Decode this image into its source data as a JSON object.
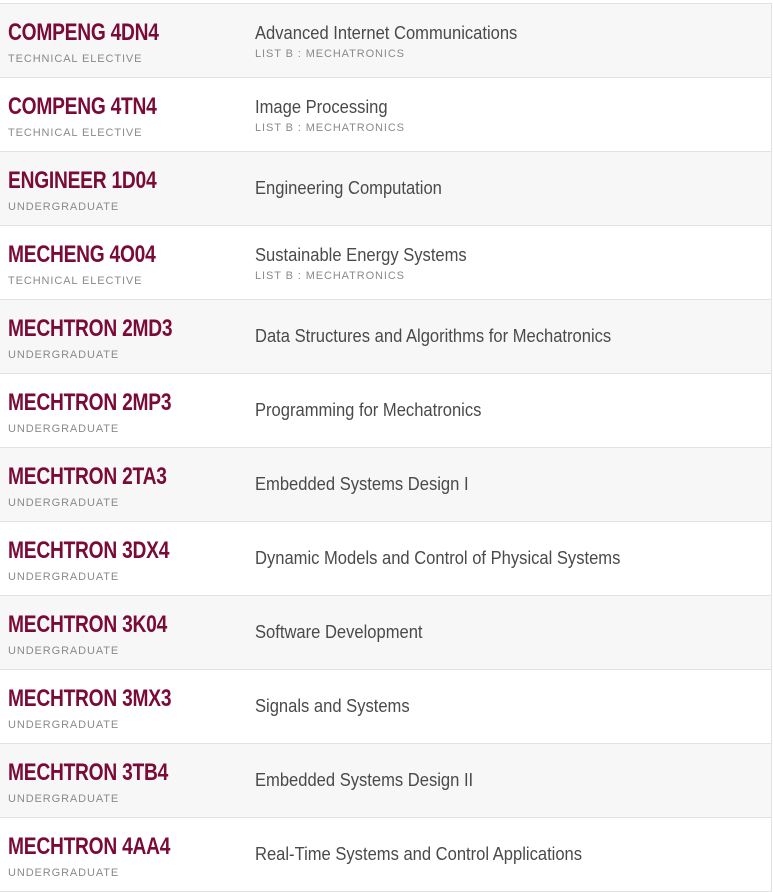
{
  "courses": [
    {
      "code": "COMPENG 4DN4",
      "level": "TECHNICAL ELECTIVE",
      "title": "Advanced Internet Communications",
      "list": "LIST B : MECHATRONICS"
    },
    {
      "code": "COMPENG 4TN4",
      "level": "TECHNICAL ELECTIVE",
      "title": "Image Processing",
      "list": "LIST B : MECHATRONICS"
    },
    {
      "code": "ENGINEER 1D04",
      "level": "UNDERGRADUATE",
      "title": "Engineering Computation",
      "list": ""
    },
    {
      "code": "MECHENG 4O04",
      "level": "TECHNICAL ELECTIVE",
      "title": "Sustainable Energy Systems",
      "list": "LIST B : MECHATRONICS"
    },
    {
      "code": "MECHTRON 2MD3",
      "level": "UNDERGRADUATE",
      "title": "Data Structures and Algorithms for Mechatronics",
      "list": ""
    },
    {
      "code": "MECHTRON 2MP3",
      "level": "UNDERGRADUATE",
      "title": "Programming for Mechatronics",
      "list": ""
    },
    {
      "code": "MECHTRON 2TA3",
      "level": "UNDERGRADUATE",
      "title": "Embedded Systems Design I",
      "list": ""
    },
    {
      "code": "MECHTRON 3DX4",
      "level": "UNDERGRADUATE",
      "title": "Dynamic Models and Control of Physical Systems",
      "list": ""
    },
    {
      "code": "MECHTRON 3K04",
      "level": "UNDERGRADUATE",
      "title": "Software Development",
      "list": ""
    },
    {
      "code": "MECHTRON 3MX3",
      "level": "UNDERGRADUATE",
      "title": "Signals and Systems",
      "list": ""
    },
    {
      "code": "MECHTRON 3TB4",
      "level": "UNDERGRADUATE",
      "title": "Embedded Systems Design II",
      "list": ""
    },
    {
      "code": "MECHTRON 4AA4",
      "level": "UNDERGRADUATE",
      "title": "Real-Time Systems and Control Applications",
      "list": ""
    }
  ],
  "colors": {
    "code": "#7a0a36",
    "title": "#4a4a4a",
    "meta": "#8a8a8a",
    "row_alt": "#f7f7f7",
    "border": "#e2e2e2"
  }
}
